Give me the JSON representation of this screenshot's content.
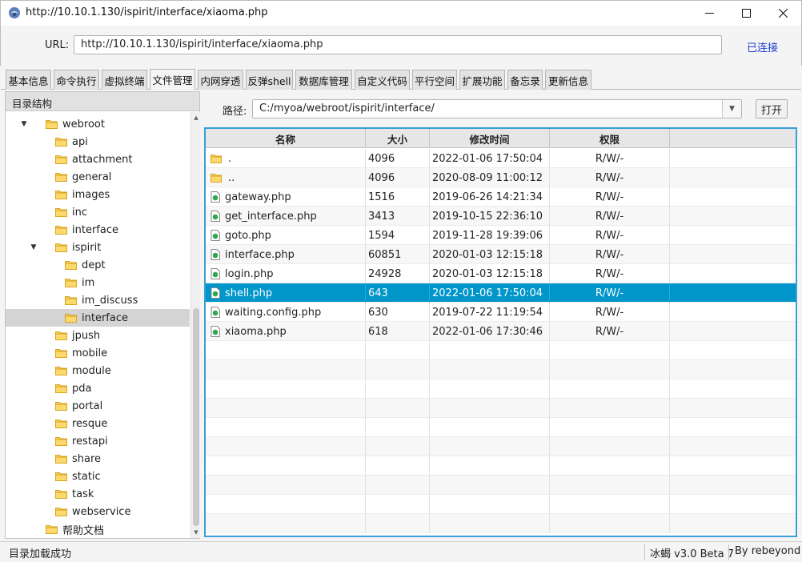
{
  "window": {
    "title": "http://10.10.1.130/ispirit/interface/xiaoma.php"
  },
  "urlbar": {
    "label": "URL:",
    "value": "http://10.10.1.130/ispirit/interface/xiaoma.php",
    "status": "已连接"
  },
  "tabs": [
    {
      "label": "基本信息"
    },
    {
      "label": "命令执行"
    },
    {
      "label": "虚拟终端"
    },
    {
      "label": "文件管理",
      "active": true
    },
    {
      "label": "内网穿透"
    },
    {
      "label": "反弹shell"
    },
    {
      "label": "数据库管理"
    },
    {
      "label": "自定义代码"
    },
    {
      "label": "平行空间"
    },
    {
      "label": "扩展功能"
    },
    {
      "label": "备忘录"
    },
    {
      "label": "更新信息"
    }
  ],
  "tree": {
    "header": "目录结构",
    "items": [
      {
        "label": "webroot",
        "expanded": true
      },
      {
        "label": "api"
      },
      {
        "label": "attachment"
      },
      {
        "label": "general"
      },
      {
        "label": "images"
      },
      {
        "label": "inc"
      },
      {
        "label": "interface"
      },
      {
        "label": "ispirit",
        "expanded": true
      },
      {
        "label": "dept"
      },
      {
        "label": "im"
      },
      {
        "label": "im_discuss"
      },
      {
        "label": "interface",
        "selected": true
      },
      {
        "label": "jpush"
      },
      {
        "label": "mobile"
      },
      {
        "label": "module"
      },
      {
        "label": "pda"
      },
      {
        "label": "portal"
      },
      {
        "label": "resque"
      },
      {
        "label": "restapi"
      },
      {
        "label": "share"
      },
      {
        "label": "static"
      },
      {
        "label": "task"
      },
      {
        "label": "webservice"
      },
      {
        "label": "帮助文档"
      }
    ]
  },
  "path": {
    "label": "路径:",
    "value": "C:/myoa/webroot/ispirit/interface/",
    "open_button": "打开"
  },
  "table": {
    "columns": [
      "名称",
      "大小",
      "修改时间",
      "权限"
    ],
    "rows": [
      {
        "type": "dir",
        "name": ".",
        "size": "4096",
        "mtime": "2022-01-06 17:50:04",
        "perm": "R/W/-"
      },
      {
        "type": "dir",
        "name": "..",
        "size": "4096",
        "mtime": "2020-08-09 11:00:12",
        "perm": "R/W/-"
      },
      {
        "type": "file",
        "name": "gateway.php",
        "size": "1516",
        "mtime": "2019-06-26 14:21:34",
        "perm": "R/W/-"
      },
      {
        "type": "file",
        "name": "get_interface.php",
        "size": "3413",
        "mtime": "2019-10-15 22:36:10",
        "perm": "R/W/-"
      },
      {
        "type": "file",
        "name": "goto.php",
        "size": "1594",
        "mtime": "2019-11-28 19:39:06",
        "perm": "R/W/-"
      },
      {
        "type": "file",
        "name": "interface.php",
        "size": "60851",
        "mtime": "2020-01-03 12:15:18",
        "perm": "R/W/-"
      },
      {
        "type": "file",
        "name": "login.php",
        "size": "24928",
        "mtime": "2020-01-03 12:15:18",
        "perm": "R/W/-"
      },
      {
        "type": "file",
        "name": "shell.php",
        "size": "643",
        "mtime": "2022-01-06 17:50:04",
        "perm": "R/W/-",
        "selected": true
      },
      {
        "type": "file",
        "name": "waiting.config.php",
        "size": "630",
        "mtime": "2019-07-22 11:19:54",
        "perm": "R/W/-"
      },
      {
        "type": "file",
        "name": "xiaoma.php",
        "size": "618",
        "mtime": "2022-01-06 17:30:46",
        "perm": "R/W/-"
      }
    ]
  },
  "statusbar": {
    "message": "目录加载成功",
    "version": "冰蝎 v3.0 Beta 7",
    "author": "By rebeyond"
  },
  "colors": {
    "selection": "#0096c9",
    "table_border": "#3a9fd6",
    "link": "#1e3fd4",
    "folder": "#f5c542",
    "php_file": "#2fa84f"
  }
}
